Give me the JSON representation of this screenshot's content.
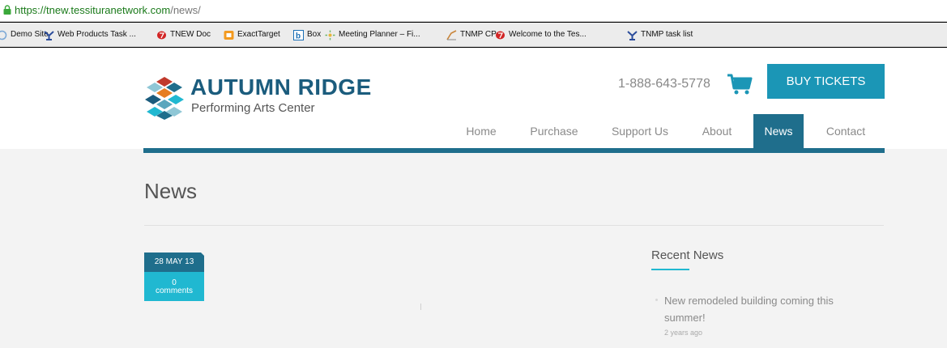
{
  "browser": {
    "url_scheme_host": "https://tnew.tessituranetwork.com",
    "url_path": "/news/"
  },
  "bookmarks": [
    {
      "label": "Demo Site",
      "icon": "globe-icon",
      "color": "#7aa7d6"
    },
    {
      "label": "Web Products Task ...",
      "icon": "tnmp-icon",
      "color": "#2b4c9b"
    },
    {
      "label": "TNEW Doc",
      "icon": "red-blob-icon",
      "color": "#d22626"
    },
    {
      "label": "ExactTarget",
      "icon": "orange-square-icon",
      "color": "#f39a1f"
    },
    {
      "label": "Box",
      "icon": "box-icon",
      "color": "#1b6fb5"
    },
    {
      "label": "Meeting Planner – Fi...",
      "icon": "sparkle-icon",
      "color": "#6cb86a"
    },
    {
      "label": "TNMP CP",
      "icon": "chart-icon",
      "color": "#c9853a"
    },
    {
      "label": "Welcome to the Tes...",
      "icon": "red-blob-icon",
      "color": "#d22626"
    },
    {
      "label": "TNMP task list",
      "icon": "tnmp-icon",
      "color": "#2b4c9b"
    }
  ],
  "header": {
    "brand": "AUTUMN RIDGE",
    "subtitle": "Performing Arts Center",
    "phone": "1-888-643-5778",
    "buy_label": "BUY TICKETS"
  },
  "nav": [
    {
      "label": "Home",
      "active": false
    },
    {
      "label": "Purchase",
      "active": false
    },
    {
      "label": "Support Us",
      "active": false
    },
    {
      "label": "About",
      "active": false
    },
    {
      "label": "News",
      "active": true
    },
    {
      "label": "Contact",
      "active": false
    }
  ],
  "main": {
    "title": "News",
    "post": {
      "date": "28 MAY 13",
      "comment_count": "0",
      "comment_label": "comments"
    }
  },
  "sidebar": {
    "title": "Recent News",
    "items": [
      {
        "title": "New remodeled building coming this summer!",
        "ago": "2 years ago"
      }
    ]
  },
  "colors": {
    "brand": "#1b5c7d",
    "accent": "#1b96b6",
    "nav_active": "#1f6e8c",
    "teal": "#20b8d1"
  }
}
